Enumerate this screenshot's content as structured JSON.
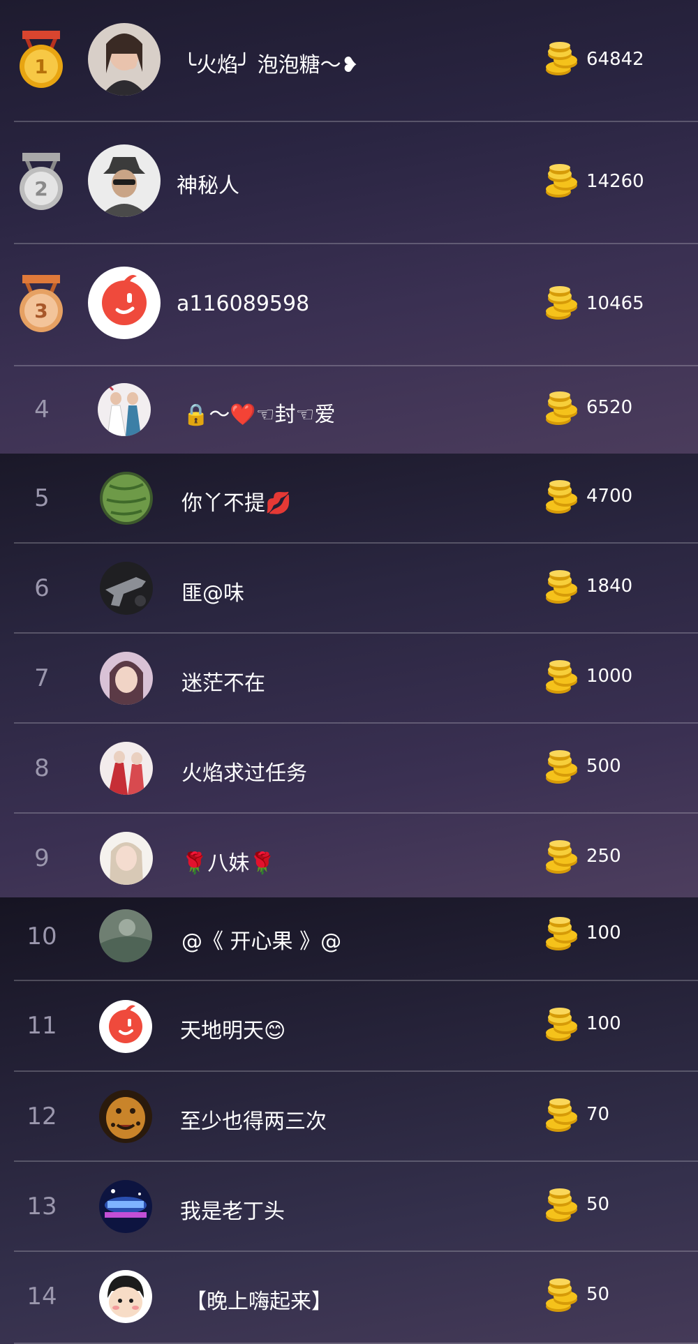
{
  "colors": {
    "coin": "#f5c21b",
    "rank_text": "#9b97ad",
    "divider": "#4a4660"
  },
  "rankings": [
    {
      "rank": "1",
      "name": "╰火焰╯ 泡泡糖～❥",
      "amount": "64842",
      "medal": "gold"
    },
    {
      "rank": "2",
      "name": "神秘人",
      "amount": "14260",
      "medal": "silver"
    },
    {
      "rank": "3",
      "name": "a116089598",
      "amount": "10465",
      "medal": "bronze"
    },
    {
      "rank": "4",
      "name": "🔒～❤️☜封☜爱",
      "amount": "6520"
    },
    {
      "rank": "5",
      "name": "你丫不提💋",
      "amount": "4700"
    },
    {
      "rank": "6",
      "name": "匪@味",
      "amount": "1840"
    },
    {
      "rank": "7",
      "name": "迷茫不在",
      "amount": "1000"
    },
    {
      "rank": "8",
      "name": "火焰求过任务",
      "amount": "500"
    },
    {
      "rank": "9",
      "name": "🌹八妹🌹",
      "amount": "250"
    },
    {
      "rank": "10",
      "name": "@《 开心果 》@",
      "amount": "100"
    },
    {
      "rank": "11",
      "name": "天地明天😊",
      "amount": "100"
    },
    {
      "rank": "12",
      "name": "至少也得两三次",
      "amount": "70"
    },
    {
      "rank": "13",
      "name": "我是老丁头",
      "amount": "50"
    },
    {
      "rank": "14",
      "name": "【晚上嗨起来】",
      "amount": "50"
    }
  ]
}
